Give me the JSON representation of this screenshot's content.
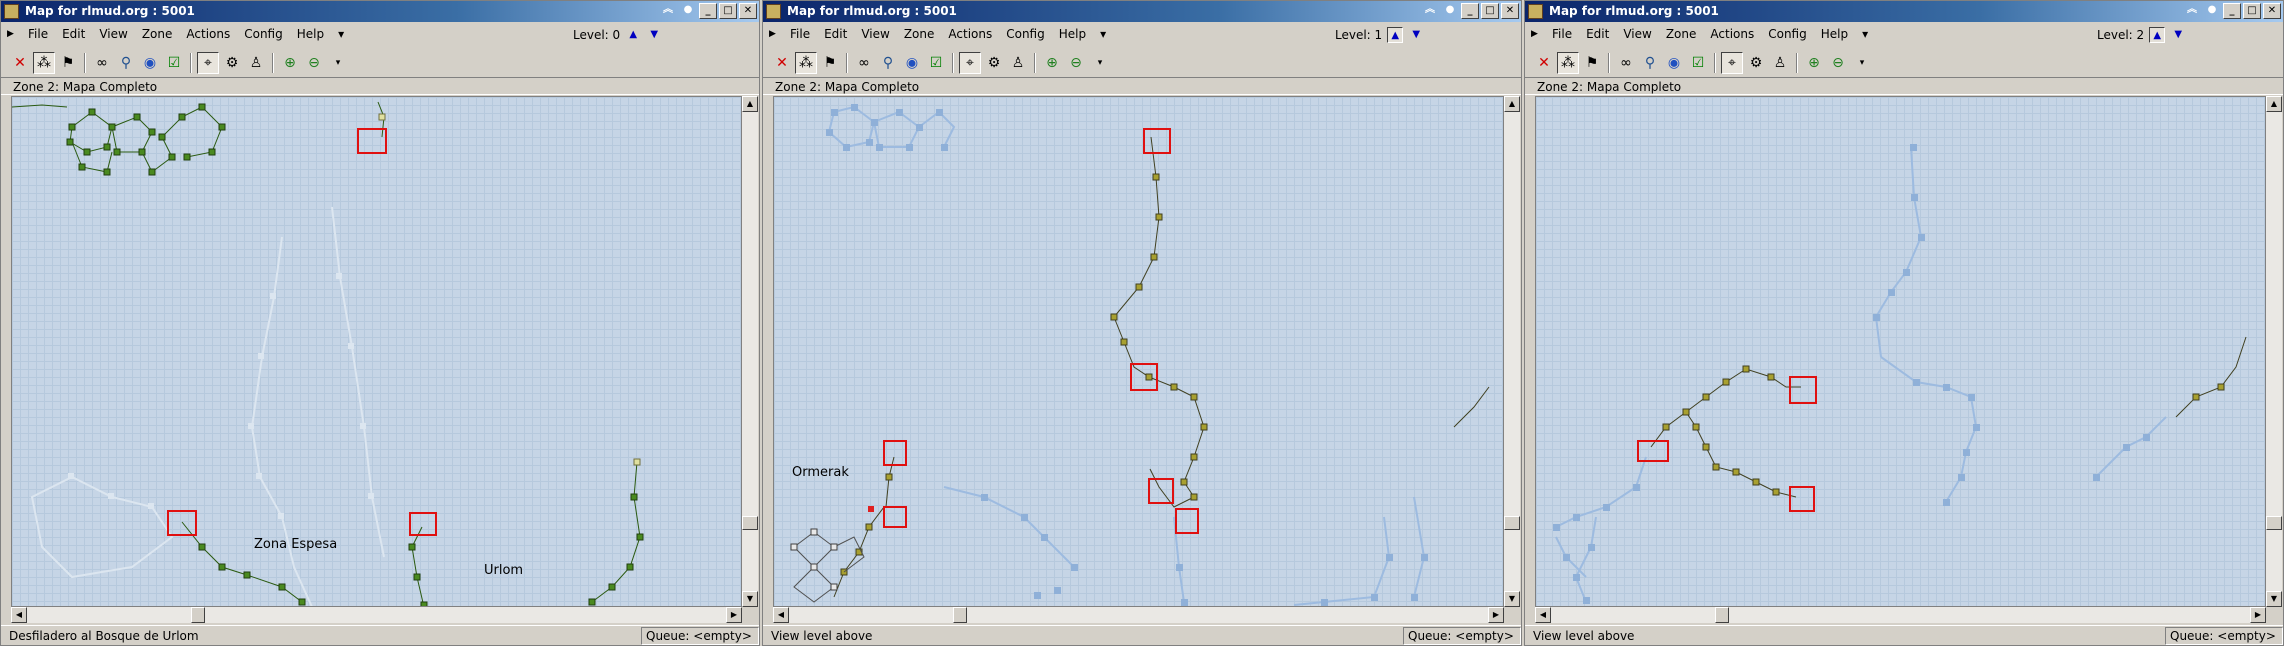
{
  "windows": [
    {
      "title": "Map for rlmud.org : 5001",
      "menu": [
        "File",
        "Edit",
        "View",
        "Zone",
        "Actions",
        "Config",
        "Help"
      ],
      "level_label": "Level: 0",
      "zone_label": "Zone 2: Mapa Completo",
      "map_labels": [
        "Zona Espesa",
        "Urlom"
      ],
      "status_left": "Desfiladero al Bosque de Urlom",
      "status_right": "Queue: <empty>"
    },
    {
      "title": "Map for rlmud.org : 5001",
      "menu": [
        "File",
        "Edit",
        "View",
        "Zone",
        "Actions",
        "Config",
        "Help"
      ],
      "level_label": "Level: 1",
      "zone_label": "Zone 2: Mapa Completo",
      "map_labels": [
        "Ormerak"
      ],
      "status_left": "View level above",
      "status_right": "Queue: <empty>"
    },
    {
      "title": "Map for rlmud.org : 5001",
      "menu": [
        "File",
        "Edit",
        "View",
        "Zone",
        "Actions",
        "Config",
        "Help"
      ],
      "level_label": "Level: 2",
      "zone_label": "Zone 2: Mapa Completo",
      "map_labels": [],
      "status_left": "View level above",
      "status_right": "Queue: <empty>"
    }
  ],
  "icons": {
    "title_buttons": [
      "restore-up-icon",
      "help-icon",
      "minimize-icon",
      "maximize-icon",
      "close-icon"
    ],
    "toolbar": [
      "delete-icon",
      "map-grid-icon",
      "auto-map-icon",
      "binoculars-icon",
      "find-icon",
      "paint-icon",
      "checkbox-icon",
      "select-icon",
      "walk-path-icon",
      "walker-icon",
      "zoom-in-icon",
      "zoom-out-icon"
    ]
  },
  "colors": {
    "map_background": "#c6d5e6",
    "room_current_level": "#5a7a20",
    "room_other_level": "#8fb0d8",
    "room_ghost": "#d8e2ee",
    "highlight_box": "#e01010",
    "titlebar": "#0a246a"
  }
}
